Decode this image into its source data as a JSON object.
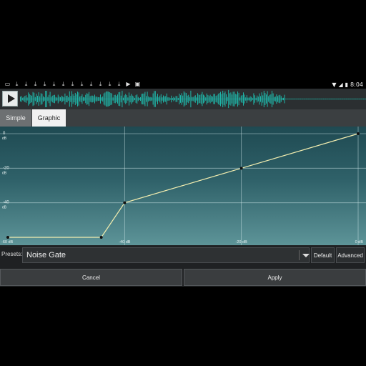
{
  "status_bar": {
    "left_icons": [
      "screen-icon",
      "download-icon",
      "download-icon",
      "download-icon",
      "download-icon",
      "download-icon",
      "download-icon",
      "download-icon",
      "download-icon",
      "download-icon",
      "download-icon",
      "download-icon",
      "download-icon",
      "play-icon",
      "image-icon"
    ],
    "time": "8:04"
  },
  "tabs": [
    {
      "label": "Simple",
      "active": false
    },
    {
      "label": "Graphic",
      "active": true
    }
  ],
  "graph": {
    "y_labels": [
      {
        "value": "0",
        "unit": "dB"
      },
      {
        "value": "-20",
        "unit": "dB"
      },
      {
        "value": "-40",
        "unit": "dB"
      }
    ],
    "x_labels": [
      "-60 dB",
      "-40 dB",
      "-20 dB",
      "0 dB"
    ],
    "curve_points": [
      {
        "in_db": -60,
        "out_db": -60
      },
      {
        "in_db": -44,
        "out_db": -60
      },
      {
        "in_db": -40,
        "out_db": -40
      },
      {
        "in_db": -20,
        "out_db": -20
      },
      {
        "in_db": 0,
        "out_db": 0
      }
    ],
    "line_color": "#f3eeb0"
  },
  "presets": {
    "label": "Presets:",
    "value": "Noise Gate",
    "default_label": "Default",
    "advanced_label": "Advanced"
  },
  "actions": {
    "cancel_label": "Cancel",
    "apply_label": "Apply"
  },
  "colors": {
    "waveform": "#1fb5a8",
    "accent": "#f3eeb0"
  }
}
